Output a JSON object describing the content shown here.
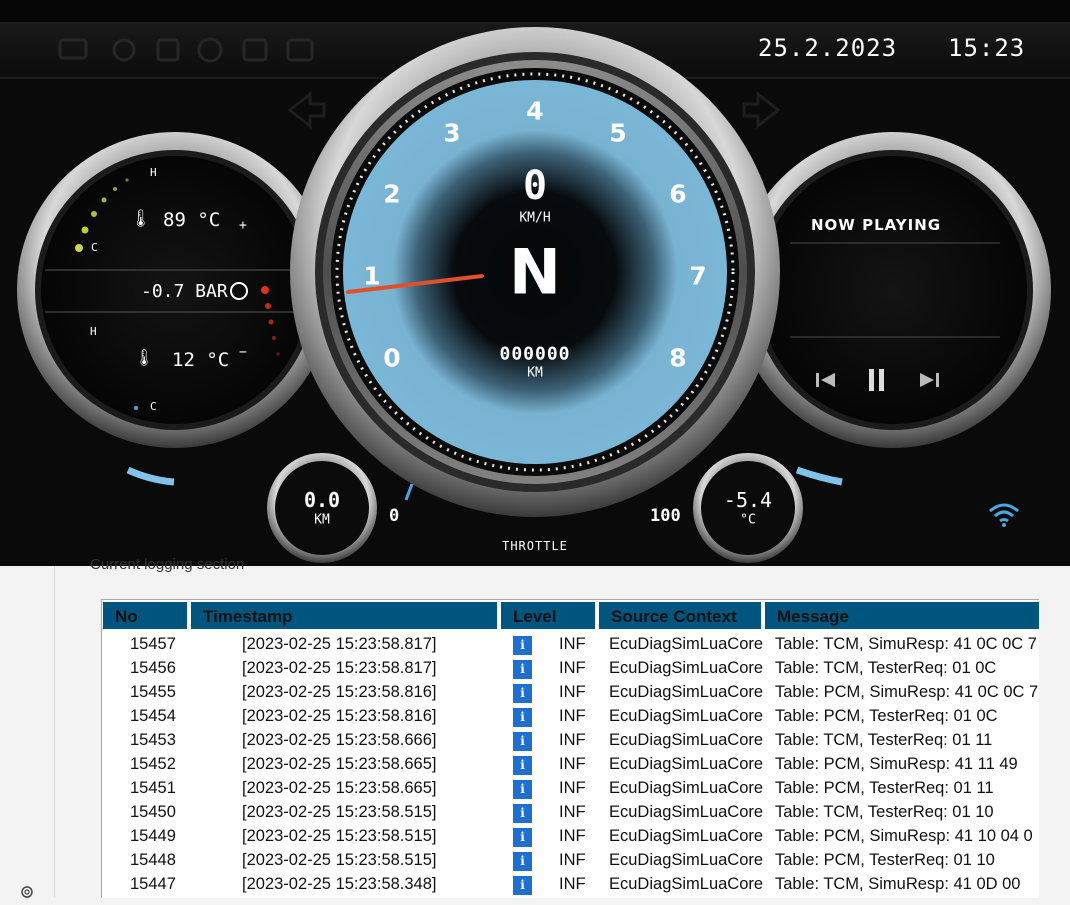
{
  "dashboard": {
    "date": "25.2.2023",
    "time": "15:23",
    "speedometer": {
      "speed": "0",
      "speed_unit": "KM/H",
      "gear": "N",
      "odometer": "000000",
      "odometer_unit": "KM",
      "scale": [
        "0",
        "1",
        "2",
        "3",
        "4",
        "5",
        "6",
        "7",
        "8"
      ],
      "needle_value": 1.0
    },
    "left_gauge": {
      "coolant_temp": "89 °C",
      "boost": "-0.7 BAR",
      "oil_temp": "12 °C",
      "label_h": "H",
      "label_c": "C",
      "plus": "+",
      "minus": "−"
    },
    "media": {
      "status": "NOW PLAYING"
    },
    "trip": {
      "value": "0.0",
      "unit": "KM"
    },
    "outside_temp": {
      "value": "-5.4",
      "unit": "°C"
    },
    "throttle": {
      "label": "THROTTLE",
      "min": "0",
      "max": "100"
    }
  },
  "section_label": "Current logging section",
  "log": {
    "columns": [
      "No",
      "Timestamp",
      "Level",
      "Source Context",
      "Message"
    ],
    "rows": [
      {
        "no": "15457",
        "ts": "[2023-02-25 15:23:58.817]",
        "level": "INF",
        "source": "EcuDiagSimLuaCore",
        "msg": "Table: TCM, SimuResp: 41 0C 0C 7"
      },
      {
        "no": "15456",
        "ts": "[2023-02-25 15:23:58.817]",
        "level": "INF",
        "source": "EcuDiagSimLuaCore",
        "msg": "Table: TCM, TesterReq: 01 0C"
      },
      {
        "no": "15455",
        "ts": "[2023-02-25 15:23:58.816]",
        "level": "INF",
        "source": "EcuDiagSimLuaCore",
        "msg": "Table: PCM, SimuResp: 41 0C 0C 7"
      },
      {
        "no": "15454",
        "ts": "[2023-02-25 15:23:58.816]",
        "level": "INF",
        "source": "EcuDiagSimLuaCore",
        "msg": "Table: PCM, TesterReq: 01 0C"
      },
      {
        "no": "15453",
        "ts": "[2023-02-25 15:23:58.666]",
        "level": "INF",
        "source": "EcuDiagSimLuaCore",
        "msg": "Table: TCM, TesterReq: 01 11"
      },
      {
        "no": "15452",
        "ts": "[2023-02-25 15:23:58.665]",
        "level": "INF",
        "source": "EcuDiagSimLuaCore",
        "msg": "Table: PCM, SimuResp: 41 11 49"
      },
      {
        "no": "15451",
        "ts": "[2023-02-25 15:23:58.665]",
        "level": "INF",
        "source": "EcuDiagSimLuaCore",
        "msg": "Table: PCM, TesterReq: 01 11"
      },
      {
        "no": "15450",
        "ts": "[2023-02-25 15:23:58.515]",
        "level": "INF",
        "source": "EcuDiagSimLuaCore",
        "msg": "Table: TCM, TesterReq: 01 10"
      },
      {
        "no": "15449",
        "ts": "[2023-02-25 15:23:58.515]",
        "level": "INF",
        "source": "EcuDiagSimLuaCore",
        "msg": "Table: PCM, SimuResp: 41 10 04 0"
      },
      {
        "no": "15448",
        "ts": "[2023-02-25 15:23:58.515]",
        "level": "INF",
        "source": "EcuDiagSimLuaCore",
        "msg": "Table: PCM, TesterReq: 01 10"
      },
      {
        "no": "15447",
        "ts": "[2023-02-25 15:23:58.348]",
        "level": "INF",
        "source": "EcuDiagSimLuaCore",
        "msg": "Table: TCM, SimuResp: 41 0D 00"
      }
    ]
  },
  "colors": {
    "dial_face": "#79b3d2",
    "needle": "#e0502a",
    "header": "#00557f",
    "info_icon": "#1f6fd1",
    "accent_blue": "#4aa6e0"
  },
  "icons": [
    "settings-gear-icon",
    "wifi-icon",
    "play-pause-icon",
    "next-track-icon",
    "previous-track-icon",
    "turbo-icon",
    "coolant-thermometer-icon",
    "oil-thermometer-icon"
  ]
}
